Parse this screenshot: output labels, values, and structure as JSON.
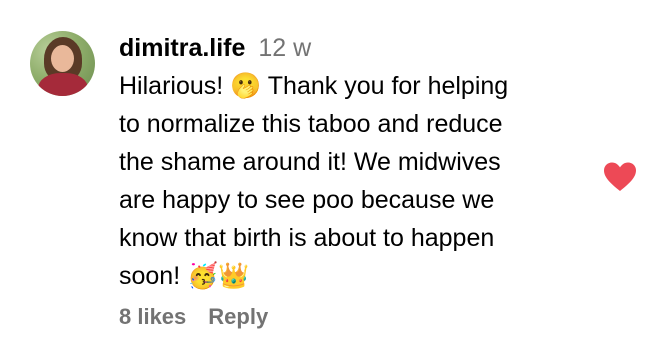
{
  "comment": {
    "username": "dimitra.life",
    "timestamp": "12 w",
    "text": "Hilarious! 🫢 Thank you for helping\nto normalize this taboo and reduce\nthe shame around it! We midwives\nare happy to see poo because we\nknow that birth is about to happen\nsoon! 🥳👑",
    "likes": "8 likes",
    "reply_label": "Reply"
  },
  "icons": {
    "like": "heart-icon",
    "avatar": "profile-photo"
  },
  "colors": {
    "heart": "#ed4956",
    "secondary_text": "#737373",
    "primary_text": "#000000"
  }
}
